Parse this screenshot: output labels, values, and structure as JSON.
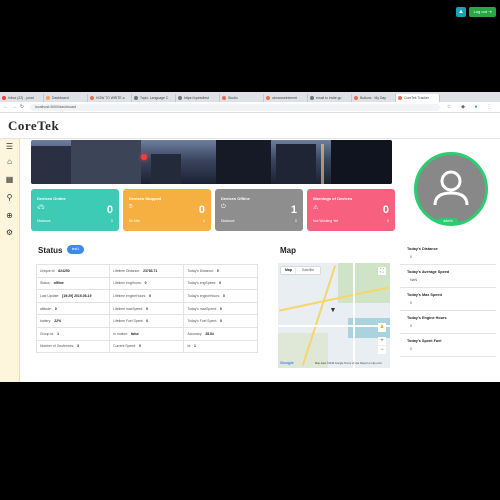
{
  "browser": {
    "tabs": [
      {
        "label": "Inbox (22) - jonat",
        "color": "#ea4335",
        "active": false
      },
      {
        "label": "Dashboard",
        "color": "#f4a261",
        "active": false
      },
      {
        "label": "HOW TO WRITE a",
        "color": "#e76f51",
        "active": false
      },
      {
        "label": "Topic: Language C",
        "color": "#6c757d",
        "active": false
      },
      {
        "label": "https://speedtest",
        "color": "#6c757d",
        "active": false
      },
      {
        "label": "Studio",
        "color": "#e76f51",
        "active": false
      },
      {
        "label": "ukmouseinternet",
        "color": "#e76f51",
        "active": false
      },
      {
        "label": "email to invite gu",
        "color": "#6c757d",
        "active": false
      },
      {
        "label": "Buttons · My Day",
        "color": "#e76f51",
        "active": false
      },
      {
        "label": "CoreTek Tracker",
        "color": "#e76f51",
        "active": true
      }
    ],
    "url": "localhost:3000/dashboard"
  },
  "header": {
    "logo": "CoreTek",
    "logout_label": "Log out"
  },
  "sidebar_icons": [
    "menu-icon",
    "home-icon",
    "map-icon",
    "route-icon",
    "add-icon",
    "settings-icon"
  ],
  "cards": [
    {
      "title": "Devices Online",
      "icon": "car-icon",
      "value": "0",
      "footer": "Distance",
      "footer_value": "0",
      "color": "#3ecbb6"
    },
    {
      "title": "Devices Stopped",
      "icon": "hand-icon",
      "value": "0",
      "footer": "En Idle",
      "footer_value": "0",
      "color": "#f5b041"
    },
    {
      "title": "Devices Offline",
      "icon": "power-icon",
      "value": "1",
      "footer": "Distance",
      "footer_value": "0",
      "color": "#8e8e8e"
    },
    {
      "title": "Warnings of Devices",
      "icon": "warning-icon",
      "value": "0",
      "footer": "Not Working Yet",
      "footer_value": "0",
      "color": "#f7617f"
    }
  ],
  "profile": {
    "badge": "admin"
  },
  "status": {
    "title": "Status",
    "test_label": "test1",
    "rows": [
      [
        {
          "label": "Unique id:",
          "value": "624250"
        },
        {
          "label": "Lifetime Distance:",
          "value": "23783.71"
        },
        {
          "label": "Today's Distance:",
          "value": "0"
        }
      ],
      [
        {
          "label": "Status:",
          "value": "offline"
        },
        {
          "label": "Lifetime engHours:",
          "value": "0"
        },
        {
          "label": "Today's engSpeed:",
          "value": "0"
        }
      ],
      [
        {
          "label": "Last Update:",
          "value": "[19:29] 2019-05-19"
        },
        {
          "label": "Lifetime engineHours:",
          "value": "0"
        },
        {
          "label": "Today's engineHours:",
          "value": "0"
        }
      ],
      [
        {
          "label": "altitude:",
          "value": "0"
        },
        {
          "label": "Lifetime maxSpeed:",
          "value": "0"
        },
        {
          "label": "Today's maxSpeed:",
          "value": "0"
        }
      ],
      [
        {
          "label": "battery:",
          "value": "22%"
        },
        {
          "label": "Lifetime Fuel Spent:",
          "value": "0"
        },
        {
          "label": "Today's Fuel Spent:",
          "value": "0"
        }
      ],
      [
        {
          "label": "Group Id:",
          "value": "1"
        },
        {
          "label": "In motion:",
          "value": "false"
        },
        {
          "label": "Accuracy:",
          "value": "28.54"
        }
      ],
      [
        {
          "label": "Number of Geofences:",
          "value": "3"
        },
        {
          "label": "Current Speed:",
          "value": "0"
        },
        {
          "label": "id:",
          "value": "1"
        }
      ]
    ]
  },
  "map": {
    "title": "Map",
    "tab_map": "Map",
    "tab_satellite": "Satellite",
    "google": "Google",
    "attribution": "Map data ©2019 Google  Terms of Use  Report a map error"
  },
  "today": [
    {
      "label": "Today's Distance",
      "value": "0"
    },
    {
      "label": "Today's Average Speed",
      "value": "NaN"
    },
    {
      "label": "Today's Max Speed",
      "value": "0"
    },
    {
      "label": "Today's Engine Hours",
      "value": "0"
    },
    {
      "label": "Today's Spent Fuel",
      "value": "0"
    }
  ]
}
